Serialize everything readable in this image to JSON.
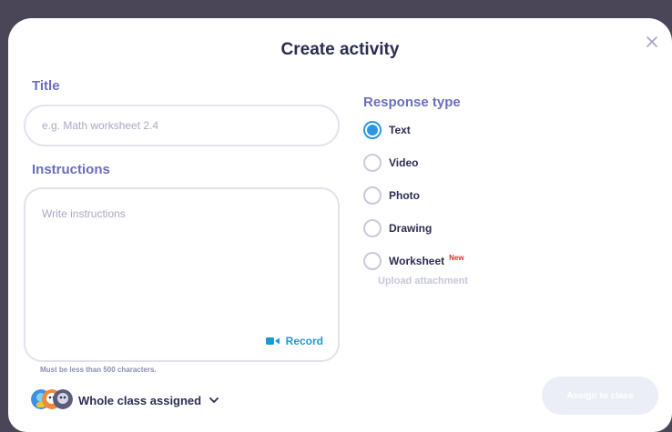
{
  "modal": {
    "title": "Create activity"
  },
  "title_section": {
    "label": "Title",
    "placeholder": "e.g. Math worksheet 2.4"
  },
  "instructions_section": {
    "label": "Instructions",
    "placeholder": "Write instructions",
    "record_label": "Record",
    "char_hint": "Must be less than 500 characters."
  },
  "response_type": {
    "label": "Response type",
    "options": [
      {
        "label": "Text",
        "selected": true
      },
      {
        "label": "Video",
        "selected": false
      },
      {
        "label": "Photo",
        "selected": false
      },
      {
        "label": "Drawing",
        "selected": false
      },
      {
        "label": "Worksheet",
        "selected": false,
        "badge": "New"
      }
    ],
    "upload_label": "Upload attachment"
  },
  "assign": {
    "label": "Whole class assigned",
    "button_label": "Assign to class"
  },
  "colors": {
    "accent": "#2c97e0",
    "label": "#6a6ebc",
    "heading": "#2b2d52",
    "new_badge": "#e0302c"
  }
}
